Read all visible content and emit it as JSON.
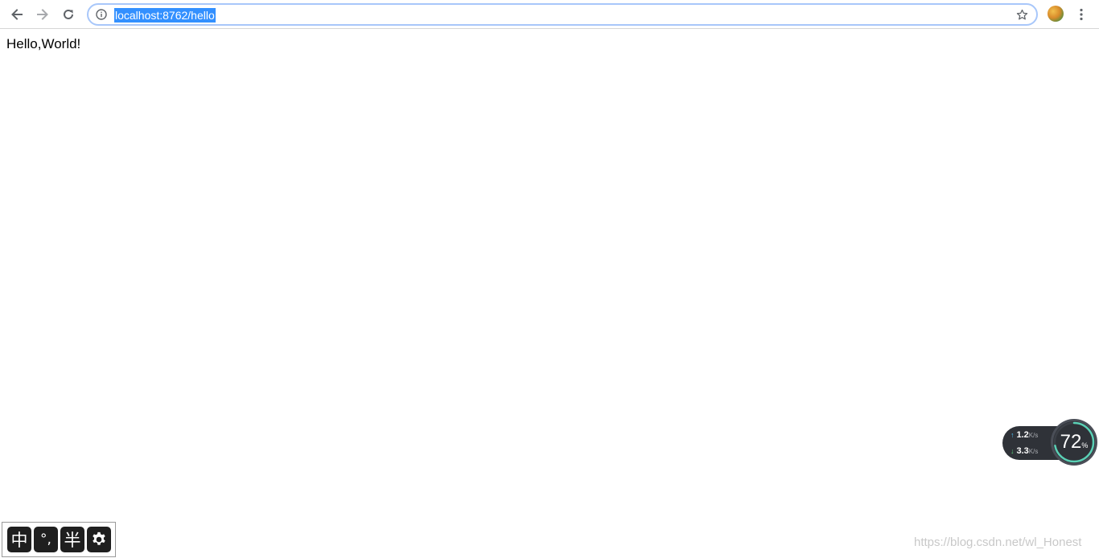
{
  "browser": {
    "url": "localhost:8762/hello",
    "icons": {
      "back": "arrow-left-icon",
      "forward": "arrow-right-icon",
      "reload": "reload-icon",
      "site_info": "info-icon",
      "bookmark": "star-icon",
      "profile": "avatar",
      "menu": "kebab-menu-icon"
    },
    "colors": {
      "url_selection": "#3390ff",
      "omnibox_focus": "#a8c7fa"
    }
  },
  "page": {
    "body_text": "Hello,World!"
  },
  "net_widget": {
    "upload_value": "1.2",
    "upload_unit": "K/s",
    "download_value": "3.3",
    "download_unit": "K/s",
    "gauge_value": "72",
    "gauge_unit": "%",
    "gauge_fraction": 0.72
  },
  "ime_bar": {
    "keys": [
      "中",
      "°,",
      "半"
    ],
    "settings_icon": "gear-icon"
  },
  "watermark": {
    "text": "https://blog.csdn.net/wl_Honest"
  }
}
